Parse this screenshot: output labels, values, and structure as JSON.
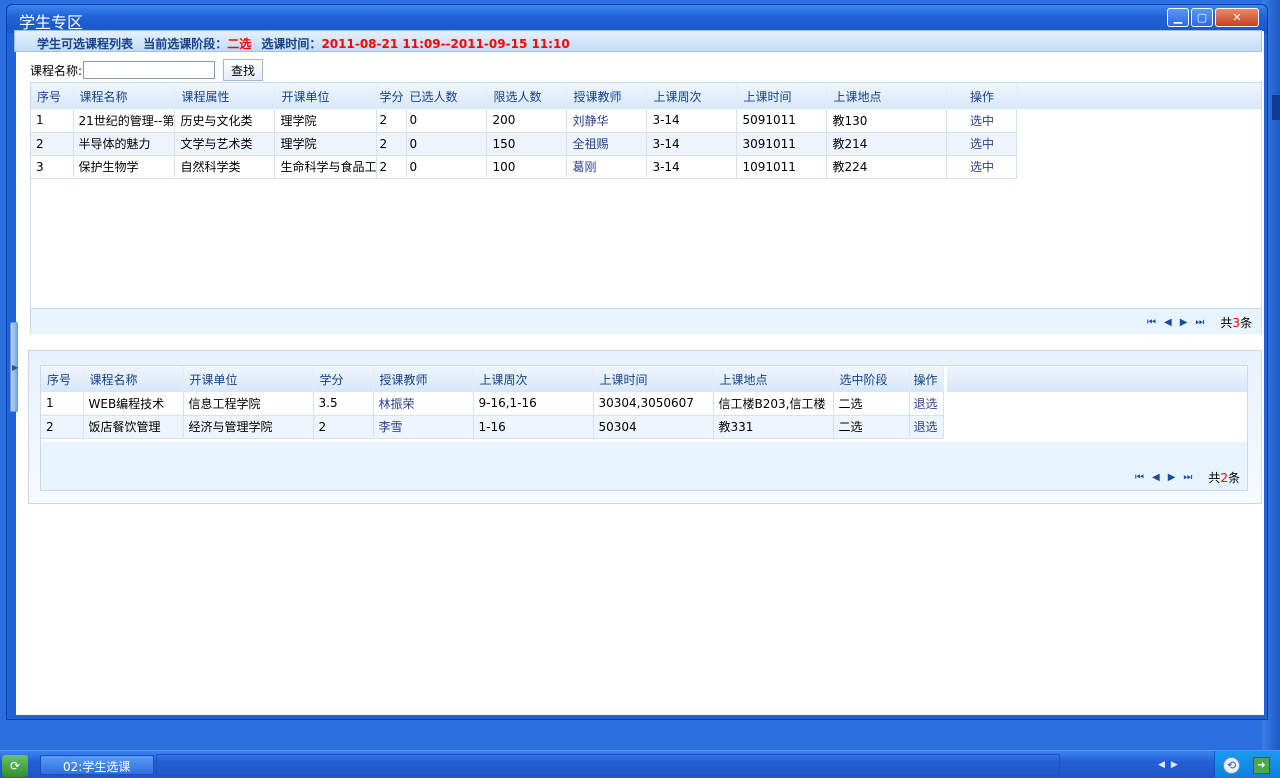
{
  "window": {
    "title": "学生专区",
    "controls": {
      "minimize": "▁",
      "maximize": "▢",
      "close": "✕"
    }
  },
  "header": {
    "list_title": "学生可选课程列表",
    "stage_label": "当前选课阶段：",
    "stage_value": "二选",
    "time_label": "选课时间：",
    "time_value": "2011-08-21 11:09--2011-09-15 11:10"
  },
  "search": {
    "label": "课程名称:",
    "value": "",
    "button_label": "查找"
  },
  "available": {
    "columns": [
      "序号",
      "课程名称",
      "课程属性",
      "开课单位",
      "学分",
      "已选人数",
      "限选人数",
      "授课教师",
      "上课周次",
      "上课时间",
      "上课地点",
      "操作"
    ],
    "rows": [
      [
        "1",
        "21世纪的管理--第",
        "历史与文化类",
        "理学院",
        "2",
        "0",
        "200",
        "刘静华",
        "3-14",
        "5091011",
        "教130",
        "选中"
      ],
      [
        "2",
        "半导体的魅力",
        "文学与艺术类",
        "理学院",
        "2",
        "0",
        "150",
        "全祖赐",
        "3-14",
        "3091011",
        "教214",
        "选中"
      ],
      [
        "3",
        "保护生物学",
        "自然科学类",
        "生命科学与食品工",
        "2",
        "0",
        "100",
        "葛刚",
        "3-14",
        "1091011",
        "教224",
        "选中"
      ]
    ],
    "pager": {
      "first": "⏮",
      "prev": "◀",
      "next": "▶",
      "last": "⏭",
      "total_prefix": "共",
      "total": "3",
      "total_suffix": "条"
    }
  },
  "selected": {
    "columns": [
      "序号",
      "课程名称",
      "开课单位",
      "学分",
      "授课教师",
      "上课周次",
      "上课时间",
      "上课地点",
      "选中阶段",
      "操作"
    ],
    "rows": [
      [
        "1",
        "WEB编程技术",
        "信息工程学院",
        "3.5",
        "林振荣",
        "9-16,1-16",
        "30304,3050607",
        "信工楼B203,信工楼",
        "二选",
        "退选"
      ],
      [
        "2",
        "饭店餐饮管理",
        "经济与管理学院",
        "2",
        "李雪",
        "1-16",
        "50304",
        "教331",
        "二选",
        "退选"
      ]
    ],
    "pager": {
      "first": "⏮",
      "prev": "◀",
      "next": "▶",
      "last": "⏭",
      "total_prefix": "共",
      "total": "2",
      "total_suffix": "条"
    }
  },
  "taskbar": {
    "task_label": "02:学生选课"
  }
}
